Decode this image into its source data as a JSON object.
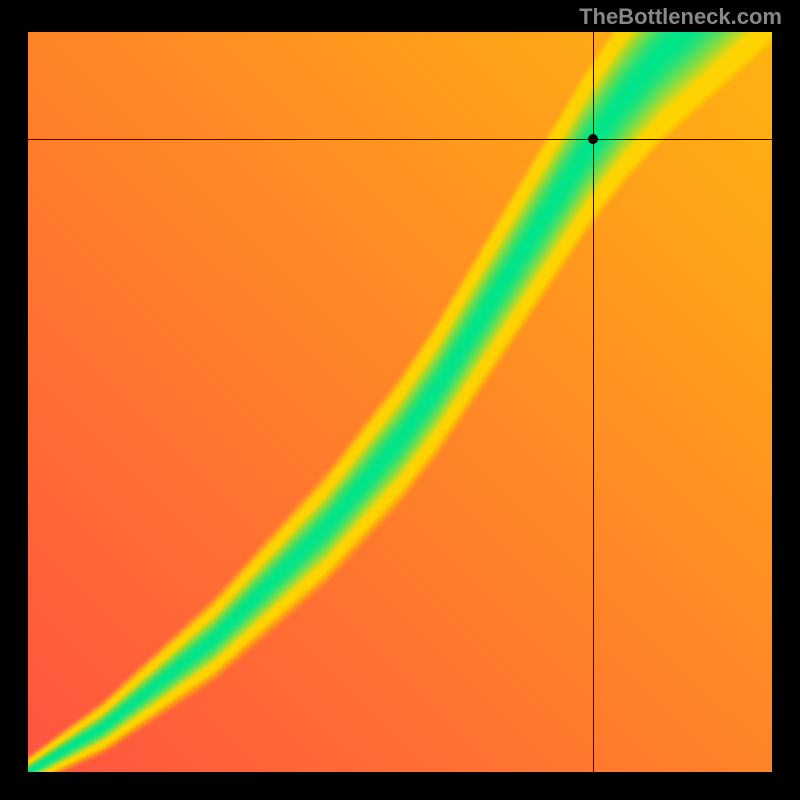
{
  "watermark": "TheBottleneck.com",
  "chart_data": {
    "type": "heatmap",
    "title": "",
    "xlabel": "",
    "ylabel": "",
    "xlim": [
      0,
      1
    ],
    "ylim": [
      0,
      1
    ],
    "crosshair": {
      "x": 0.76,
      "y": 0.855
    },
    "marker": {
      "x": 0.76,
      "y": 0.855
    },
    "color_scale": {
      "low": "#ff2a55",
      "mid": "#ffd400",
      "high": "#00e48a"
    },
    "note": "Heatmap value at (x,y) peaks where x and y are near the ideal curve y = f(x); color falls off red→yellow→green→yellow→red around the curve.",
    "ideal_curve_samples": [
      {
        "x": 0.0,
        "y": 0.0
      },
      {
        "x": 0.05,
        "y": 0.03
      },
      {
        "x": 0.1,
        "y": 0.06
      },
      {
        "x": 0.15,
        "y": 0.1
      },
      {
        "x": 0.2,
        "y": 0.14
      },
      {
        "x": 0.25,
        "y": 0.18
      },
      {
        "x": 0.3,
        "y": 0.23
      },
      {
        "x": 0.35,
        "y": 0.28
      },
      {
        "x": 0.4,
        "y": 0.33
      },
      {
        "x": 0.45,
        "y": 0.39
      },
      {
        "x": 0.5,
        "y": 0.45
      },
      {
        "x": 0.55,
        "y": 0.52
      },
      {
        "x": 0.6,
        "y": 0.6
      },
      {
        "x": 0.65,
        "y": 0.68
      },
      {
        "x": 0.7,
        "y": 0.76
      },
      {
        "x": 0.75,
        "y": 0.84
      },
      {
        "x": 0.8,
        "y": 0.91
      },
      {
        "x": 0.85,
        "y": 0.97
      },
      {
        "x": 0.9,
        "y": 1.02
      },
      {
        "x": 0.95,
        "y": 1.07
      },
      {
        "x": 1.0,
        "y": 1.12
      }
    ]
  }
}
